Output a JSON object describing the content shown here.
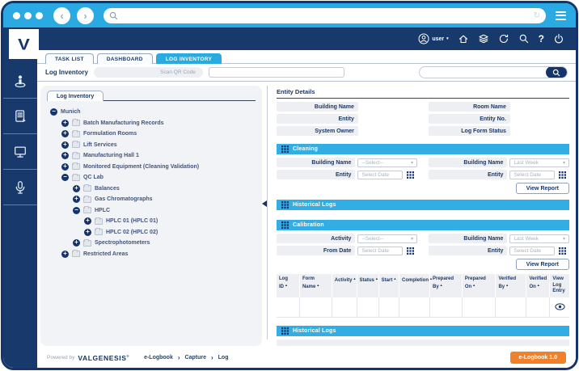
{
  "colors": {
    "navy": "#14346B",
    "chrome_blue": "#2BA9E2",
    "section_cyan": "#33AEE4",
    "accent_orange": "#F0812A",
    "label_gray_bg": "#EDEFF3"
  },
  "browser": {
    "url_value": ""
  },
  "header": {
    "logo_letter": "V",
    "user_label": "user",
    "user_caret": "▾"
  },
  "tabs": [
    {
      "label": "TASK LIST",
      "state": "inactive"
    },
    {
      "label": "DASHBOARD",
      "state": "inactive"
    },
    {
      "label": "LOG INVENTORY",
      "state": "active"
    }
  ],
  "subheader": {
    "title": "Log Inventory",
    "scan_qr_label": "Scan QR Code",
    "qr_value": "",
    "search_value": ""
  },
  "tree_panel": {
    "tab_label": "Log Inventory",
    "nodes": [
      {
        "label": "Munich",
        "depth": 0,
        "toggle": "minus",
        "icon": "none"
      },
      {
        "label": "Batch Manufacturing Records",
        "depth": 1,
        "toggle": "plus",
        "icon": "folder"
      },
      {
        "label": "Formulation Rooms",
        "depth": 1,
        "toggle": "plus",
        "icon": "folder"
      },
      {
        "label": "Lift Services",
        "depth": 1,
        "toggle": "plus",
        "icon": "folder"
      },
      {
        "label": "Manufacturing Hall 1",
        "depth": 1,
        "toggle": "plus",
        "icon": "folder"
      },
      {
        "label": "Monitored Equipment (Cleaning Validation)",
        "depth": 1,
        "toggle": "plus",
        "icon": "folder"
      },
      {
        "label": "QC Lab",
        "depth": 1,
        "toggle": "minus",
        "icon": "folder"
      },
      {
        "label": "Balances",
        "depth": 2,
        "toggle": "plus",
        "icon": "folder"
      },
      {
        "label": "Gas Chromatographs",
        "depth": 2,
        "toggle": "plus",
        "icon": "folder"
      },
      {
        "label": "HPLC",
        "depth": 2,
        "toggle": "minus",
        "icon": "folder"
      },
      {
        "label": "HPLC 01 (HPLC 01)",
        "depth": 3,
        "toggle": "plus",
        "icon": "folder"
      },
      {
        "label": "HPLC 02 (HPLC 02)",
        "depth": 3,
        "toggle": "plus",
        "icon": "folder"
      },
      {
        "label": "Spectrophotometers",
        "depth": 2,
        "toggle": "plus",
        "icon": "folder"
      },
      {
        "label": "Restricted Areas",
        "depth": 1,
        "toggle": "plus",
        "icon": "folder"
      }
    ]
  },
  "entity_details": {
    "title": "Entity Details",
    "left_labels": [
      "Building Name",
      "Entity",
      "System Owner"
    ],
    "right_labels": [
      "Room Name",
      "Entity No.",
      "Log Form Status"
    ]
  },
  "cleaning": {
    "title": "Cleaning",
    "fields": {
      "left1": {
        "label": "Building Name",
        "value": "--Select--"
      },
      "left2": {
        "label": "Entity",
        "value": "Select Date"
      },
      "right1": {
        "label": "Building Name",
        "value": "Last Week"
      },
      "right2": {
        "label": "Entity",
        "value": "Select Date"
      }
    },
    "view_report_label": "View Report"
  },
  "historical_logs_1": {
    "title": "Historical Logs"
  },
  "calibration": {
    "title": "Calibration",
    "fields": {
      "left1": {
        "label": "Activity",
        "value": "--Select--"
      },
      "left2": {
        "label": "From Date",
        "value": "Select Date"
      },
      "right1": {
        "label": "Building Name",
        "value": "Last Week"
      },
      "right2": {
        "label": "Entity",
        "value": "Select Date"
      }
    },
    "view_report_label": "View Report",
    "table": {
      "headers": [
        {
          "label": "Log ID",
          "sortable": "sortable"
        },
        {
          "label": "Form Name",
          "sortable": "sortable"
        },
        {
          "label": "Activity",
          "sortable": "sortable"
        },
        {
          "label": "Status",
          "sortable": "sortable"
        },
        {
          "label": "Start",
          "sortable": "sortable"
        },
        {
          "label": "Completion",
          "sortable": "sortable"
        },
        {
          "label": "Prepared By",
          "sortable": "sortable"
        },
        {
          "label": "Prepared On",
          "sortable": "sortable"
        },
        {
          "label": "Verified By",
          "sortable": "sortable"
        },
        {
          "label": "Verified On",
          "sortable": "sortable"
        },
        {
          "label": "View Log Entry",
          "sortable": "plain"
        }
      ],
      "rows": [
        {
          "cells": [
            "",
            "",
            "",
            "",
            "",
            "",
            "",
            "",
            "",
            ""
          ],
          "action": "view"
        }
      ]
    }
  },
  "historical_logs_2": {
    "title": "Historical Logs"
  },
  "footer": {
    "powered_by": "Powered by",
    "brand": "VALGENESIS",
    "brand_mark": "®",
    "breadcrumb": [
      "e-Logbook",
      "Capture",
      "Log"
    ],
    "version_button": "e-Logbook 1.0"
  }
}
